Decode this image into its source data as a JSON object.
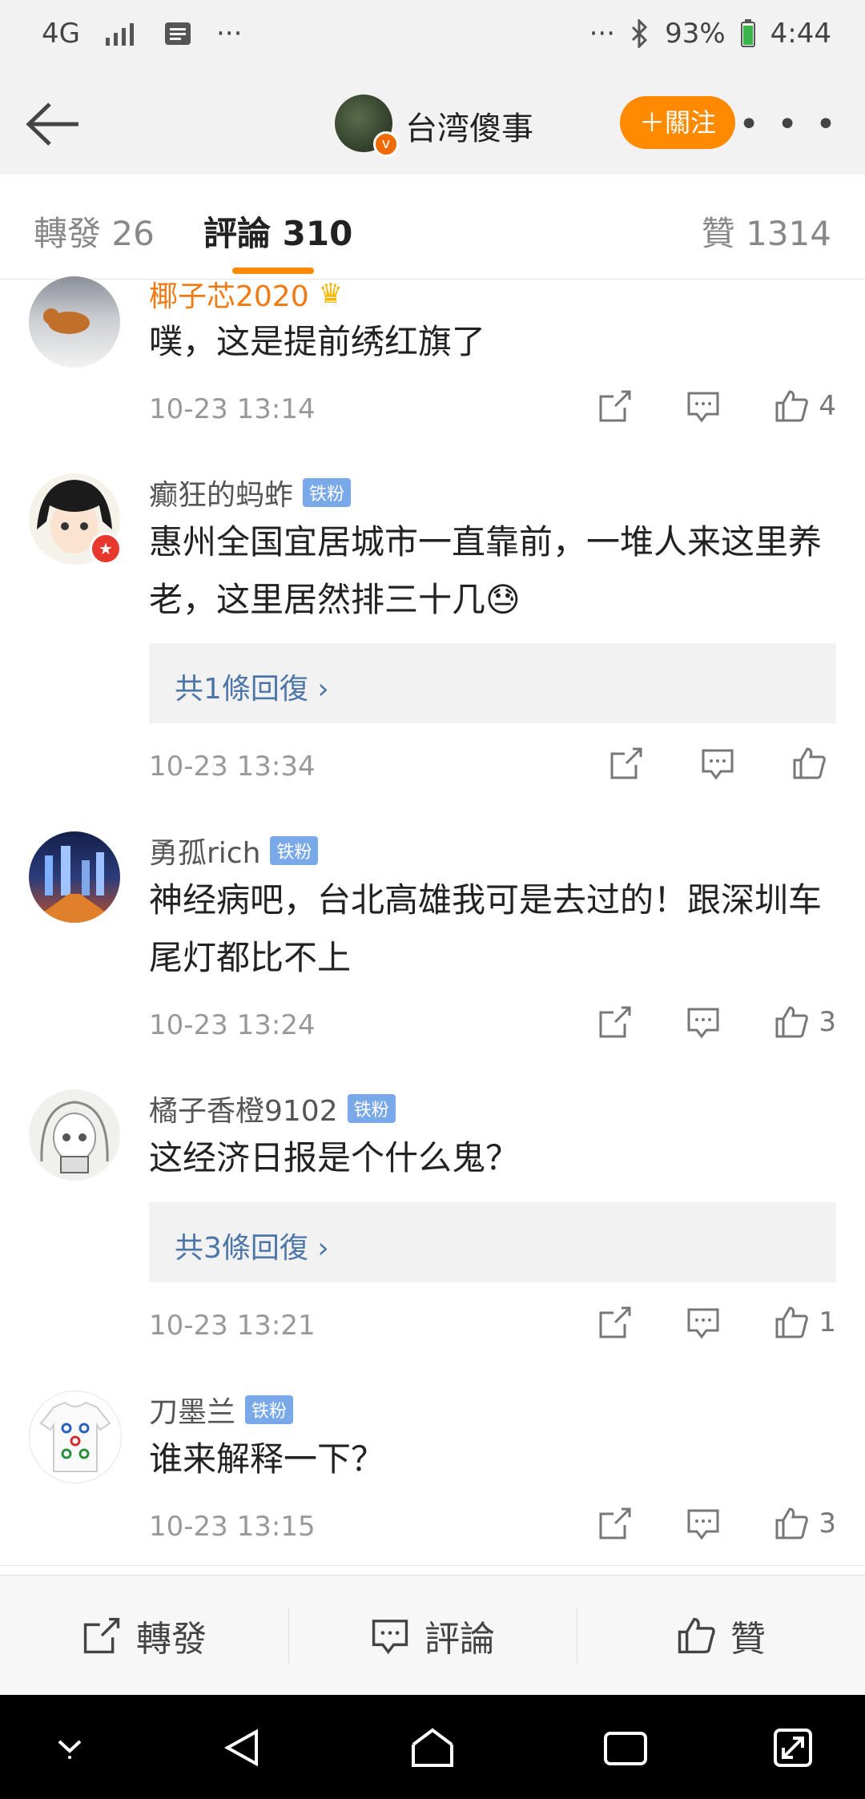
{
  "status_bar": {
    "network": "4G",
    "battery": "93%",
    "time": "4:44",
    "more": "···"
  },
  "header": {
    "account_name": "台湾傻事",
    "follow_label": "＋關注",
    "more_label": "• • •",
    "verified_badge": "v"
  },
  "tabs": {
    "repost": "轉發 26",
    "comments": "評論 310",
    "likes": "贊 1314"
  },
  "comments": [
    {
      "username": "椰子芯2020",
      "text": "噗，这是提前绣红旗了",
      "time": "10-23 13:14",
      "likes": "4"
    },
    {
      "username": "癫狂的蚂蚱",
      "badge": "铁粉",
      "text": "惠州全国宜居城市一直靠前，一堆人来这里养老，这里居然排三十几😓",
      "reply": "共1條回復 ›",
      "time": "10-23 13:34",
      "likes": ""
    },
    {
      "username": "勇孤rich",
      "badge": "铁粉",
      "text": "神经病吧，台北高雄我可是去过的！跟深圳车尾灯都比不上",
      "time": "10-23 13:24",
      "likes": "3"
    },
    {
      "username": "橘子香橙9102",
      "badge": "铁粉",
      "text": "这经济日报是个什么鬼？",
      "reply": "共3條回復 ›",
      "time": "10-23 13:21",
      "likes": "1"
    },
    {
      "username": "刀墨兰",
      "badge": "铁粉",
      "text": "谁来解释一下？",
      "time": "10-23 13:15",
      "likes": "3"
    }
  ],
  "bottom_bar": {
    "repost": "轉發",
    "comment": "評論",
    "like": "贊"
  },
  "colors": {
    "accent": "#ff8a00",
    "link": "#4d76a8",
    "badge": "#7aa9ea"
  }
}
